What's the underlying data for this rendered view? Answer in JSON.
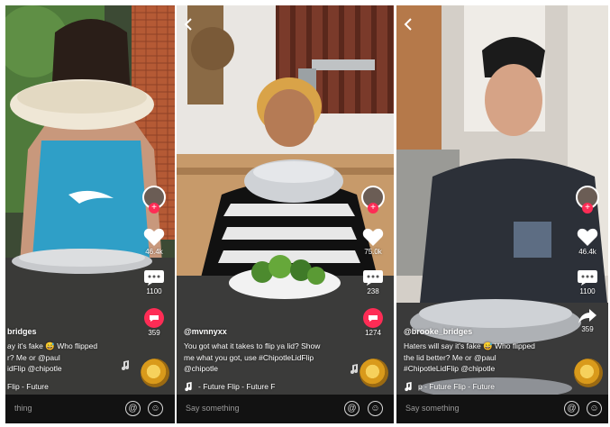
{
  "panels": [
    {
      "likes": "46.4k",
      "comments": "1100",
      "shares": "359",
      "username": "bridges",
      "caption_lines": [
        "ay it's fake 😅 Who flipped",
        "r? Me or @paul",
        "idFlip @chipotle"
      ],
      "music": "Flip - Future",
      "comment_placeholder": "thing"
    },
    {
      "likes": "75.0k",
      "comments": "238",
      "shares": "1274",
      "username": "@mvnnyxx",
      "caption_lines": [
        "You got what it takes to flip ya lid? Show",
        "me what you got, use #ChipotleLidFlip",
        "@chipotle"
      ],
      "music": "- Future     Flip - Future     F",
      "comment_placeholder": "Say something"
    },
    {
      "likes": "46.4k",
      "comments": "1100",
      "shares": "359",
      "username": "@brooke_bridges",
      "caption_lines": [
        "Haters will say it's fake 😅 Who flipped",
        "the lid better? Me or @paul",
        "#ChipotleLidFlip @chipotle"
      ],
      "music": "p - Future     Flip - Future",
      "comment_placeholder": "Say something"
    }
  ],
  "icons": {
    "like": "heart-icon",
    "comment": "comment-icon",
    "share": "share-icon",
    "mention": "at-icon",
    "emoji": "emoji-icon",
    "music": "music-note-icon",
    "back": "back-chevron-icon"
  },
  "colors": {
    "accent": "#fe2c55",
    "bar": "#121212",
    "placeholder": "#9a9a9a"
  }
}
